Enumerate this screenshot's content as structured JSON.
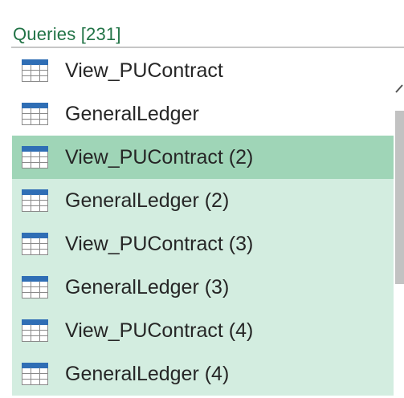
{
  "header": {
    "title": "Queries [231]"
  },
  "queries": [
    {
      "label": "View_PUContract",
      "icon": "table-icon",
      "state": "normal"
    },
    {
      "label": "GeneralLedger",
      "icon": "table-icon",
      "state": "normal"
    },
    {
      "label": "View_PUContract (2)",
      "icon": "table-icon",
      "state": "active"
    },
    {
      "label": "GeneralLedger (2)",
      "icon": "table-icon",
      "state": "selected"
    },
    {
      "label": "View_PUContract (3)",
      "icon": "table-icon",
      "state": "selected"
    },
    {
      "label": "GeneralLedger (3)",
      "icon": "table-icon",
      "state": "selected"
    },
    {
      "label": "View_PUContract (4)",
      "icon": "table-icon",
      "state": "selected"
    },
    {
      "label": "GeneralLedger (4)",
      "icon": "table-icon",
      "state": "selected"
    }
  ],
  "colors": {
    "header_text": "#217346",
    "selected_background": "#d3ede0",
    "active_background": "#9fd5b7",
    "icon_blue": "#2f6eb5",
    "scrollbar_thumb": "#c2c2c2"
  }
}
